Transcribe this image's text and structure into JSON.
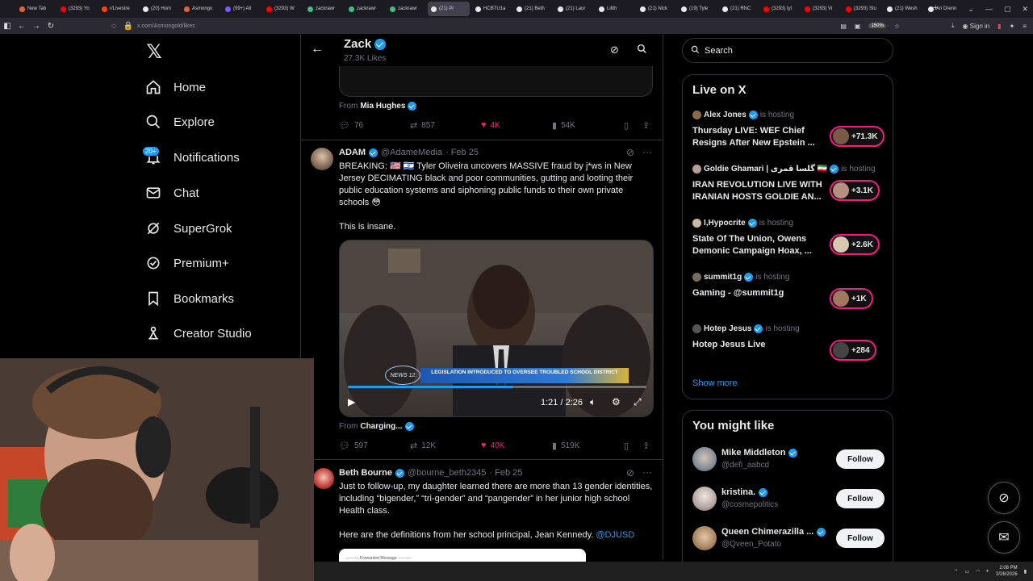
{
  "browser": {
    "tabs": [
      {
        "label": "New Tab",
        "color": "#e0663a"
      },
      {
        "label": "(3293) Yo",
        "color": "#ff0000"
      },
      {
        "label": "r/Livestre",
        "color": "#ff4500"
      },
      {
        "label": "(20) Hom",
        "color": "#e7e9ea"
      },
      {
        "label": "Asmongo",
        "color": "#e0663a"
      },
      {
        "label": "(99+) All",
        "color": "#7b5cff"
      },
      {
        "label": "(3293) W",
        "color": "#ff0000"
      },
      {
        "label": "zackrawr",
        "color": "#3fbf7f"
      },
      {
        "label": "zackrawr",
        "color": "#3fbf7f"
      },
      {
        "label": "zackrawr",
        "color": "#3fbf7f"
      },
      {
        "label": "(21) Pr",
        "color": "#e7e9ea",
        "active": true
      },
      {
        "label": "HCBTU1a",
        "color": "#e7e9ea"
      },
      {
        "label": "(21) Beth",
        "color": "#e7e9ea"
      },
      {
        "label": "(21) Laur",
        "color": "#e7e9ea"
      },
      {
        "label": "Lilith",
        "color": "#e7e9ea"
      },
      {
        "label": "(21) Nick",
        "color": "#e7e9ea"
      },
      {
        "label": "(19) Tyle",
        "color": "#e7e9ea"
      },
      {
        "label": "(21) RNC",
        "color": "#e7e9ea"
      },
      {
        "label": "(3293) tyl",
        "color": "#ff0000"
      },
      {
        "label": "(3293) Vi",
        "color": "#ff0000"
      },
      {
        "label": "(3293) Stu",
        "color": "#ff0000"
      },
      {
        "label": "(21) Wesh",
        "color": "#e7e9ea"
      },
      {
        "label": "Ari Drenn",
        "color": "#e7e9ea"
      }
    ],
    "url": "x.com/Asmongold/likes",
    "zoom": "150%",
    "signin": "Sign in"
  },
  "nav": {
    "items": [
      {
        "label": "Home",
        "icon": "home-icon"
      },
      {
        "label": "Explore",
        "icon": "search-icon"
      },
      {
        "label": "Notifications",
        "icon": "bell-icon"
      },
      {
        "label": "Chat",
        "icon": "mail-icon"
      },
      {
        "label": "SuperGrok",
        "icon": "grok-icon"
      },
      {
        "label": "Premium+",
        "icon": "premium-icon"
      },
      {
        "label": "Bookmarks",
        "icon": "bookmark-icon"
      },
      {
        "label": "Creator Studio",
        "icon": "creator-icon"
      }
    ],
    "notification_badge": "20+"
  },
  "header": {
    "name": "Zack",
    "likes": "27.3K Likes"
  },
  "prev_post": {
    "from_label": "From",
    "from_name": "Mia Hughes",
    "replies": "76",
    "reposts": "857",
    "likes": "4K",
    "views": "54K"
  },
  "post1": {
    "name": "ADAM",
    "handle": "@AdameMedia",
    "date": "· Feb 25",
    "text": "BREAKING: 🇺🇸 🇮🇱 Tyler Oliveira uncovers MASSIVE fraud by j*ws in New Jersey DECIMATING black and poor communities, gutting and looting their public education systems and siphoning public funds to their own private schools 😳",
    "text2": "This is insane.",
    "video": {
      "chyron": "LEGISLATION INTRODUCED TO OVERSEE TROUBLED SCHOOL DISTRICT",
      "logo": "NEWS 12",
      "time": "1:21 / 2:26",
      "progress": 0.555
    },
    "from_label": "From",
    "from_name": "Charging...",
    "replies": "597",
    "reposts": "12K",
    "likes": "40K",
    "views": "519K"
  },
  "post2": {
    "name": "Beth Bourne",
    "handle": "@bourne_beth2345",
    "date": "· Feb 25",
    "text": "Just to follow-up, my daughter learned there are more than 13 gender identities, including “bigender,” “tri-gender” and “pangender” in her junior high school Health class.",
    "text2": "Here are the definitions from her school principal, Jean Kennedy.",
    "mention": "@DJUSD",
    "card_label": "---------- Forwarded Message ----------"
  },
  "right": {
    "search_placeholder": "Search",
    "live_title": "Live on X",
    "is_hosting": "is hosting",
    "live": [
      {
        "host": "Alex Jones",
        "title": "Thursday LIVE: WEF Chief Resigns After New Epstein ...",
        "count": "+71.3K"
      },
      {
        "host": "Goldie Ghamari | گلسا قمری 🇮🇷",
        "title": "IRAN REVOLUTION LIVE WITH IRANIAN HOSTS GOLDIE AN...",
        "count": "+3.1K"
      },
      {
        "host": "I,Hypocrite",
        "title": "State Of The Union, Owens Demonic Campaign Hoax, ...",
        "count": "+2.6K"
      },
      {
        "host": "summit1g",
        "title": "Gaming - @summit1g",
        "count": "+1K"
      },
      {
        "host": "Hotep Jesus",
        "title": "Hotep Jesus Live",
        "count": "+284"
      }
    ],
    "show_more": "Show more",
    "suggest_title": "You might like",
    "suggestions": [
      {
        "name": "Mike Middleton",
        "handle": "@defi_aabcd",
        "follow": "Follow"
      },
      {
        "name": "kristina.",
        "handle": "@cosmepolitics",
        "follow": "Follow"
      },
      {
        "name": "Queen Chimerazilla ...",
        "handle": "@Qveen_Potato",
        "follow": "Follow"
      }
    ]
  },
  "taskbar": {
    "time": "2:08 PM",
    "date": "2/26/2026"
  }
}
